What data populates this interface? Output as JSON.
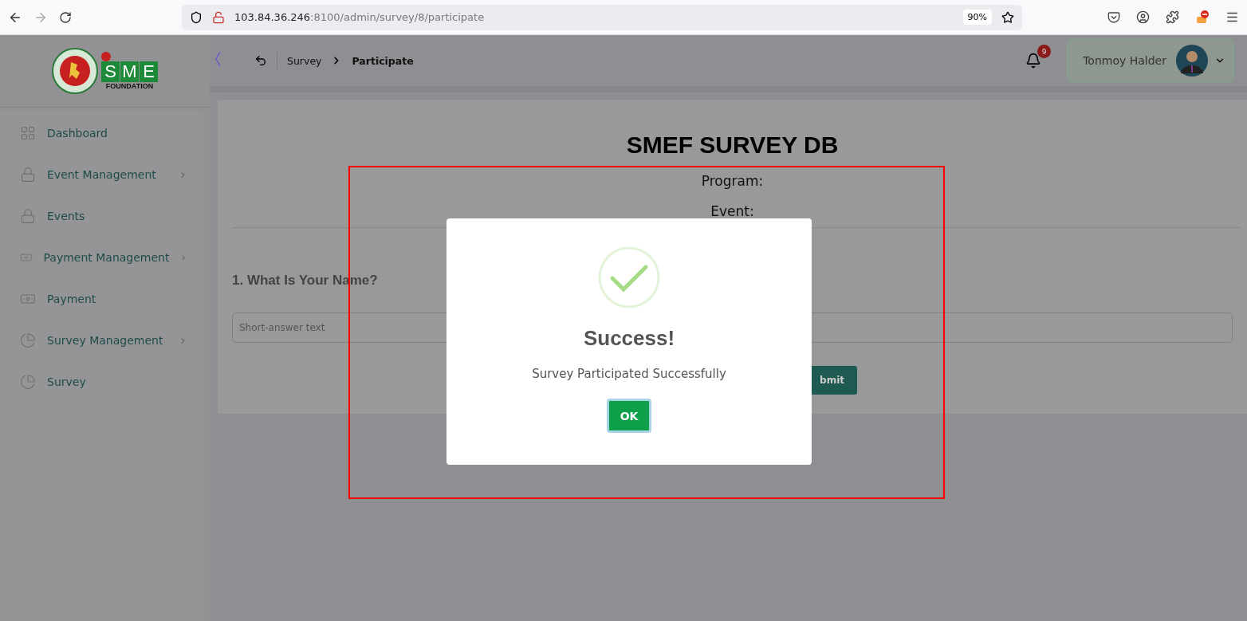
{
  "browser": {
    "url_host": "103.84.36.246",
    "url_rest": ":8100/admin/survey/8/participate",
    "zoom": "90%"
  },
  "logo": {
    "letters": [
      "S",
      "M",
      "E"
    ],
    "subtitle": "FOUNDATION"
  },
  "sidebar": {
    "items": [
      {
        "label": "Dashboard",
        "kind": "grid",
        "has_submenu": false
      },
      {
        "label": "Event Management",
        "kind": "lock",
        "has_submenu": true
      },
      {
        "label": "Events",
        "kind": "lock",
        "has_submenu": false
      },
      {
        "label": "Payment Management",
        "kind": "money",
        "has_submenu": true
      },
      {
        "label": "Payment",
        "kind": "money",
        "has_submenu": false
      },
      {
        "label": "Survey Management",
        "kind": "pie",
        "has_submenu": true
      },
      {
        "label": "Survey",
        "kind": "pie",
        "has_submenu": false
      }
    ]
  },
  "header": {
    "breadcrumb": [
      "Survey",
      "Participate"
    ],
    "notification_count": "9",
    "user_name": "Tonmoy Halder"
  },
  "form": {
    "title": "SMEF SURVEY DB",
    "meta": [
      "Program:",
      "Event:"
    ],
    "questions": [
      {
        "label": "1. What Is Your Name?",
        "placeholder": "Short-answer text"
      }
    ],
    "submit": "bmit"
  },
  "dialog": {
    "title": "Success!",
    "message": "Survey Participated Successfully",
    "button": "OK"
  },
  "annotation": {
    "shown": true,
    "color": "#ff0000"
  }
}
